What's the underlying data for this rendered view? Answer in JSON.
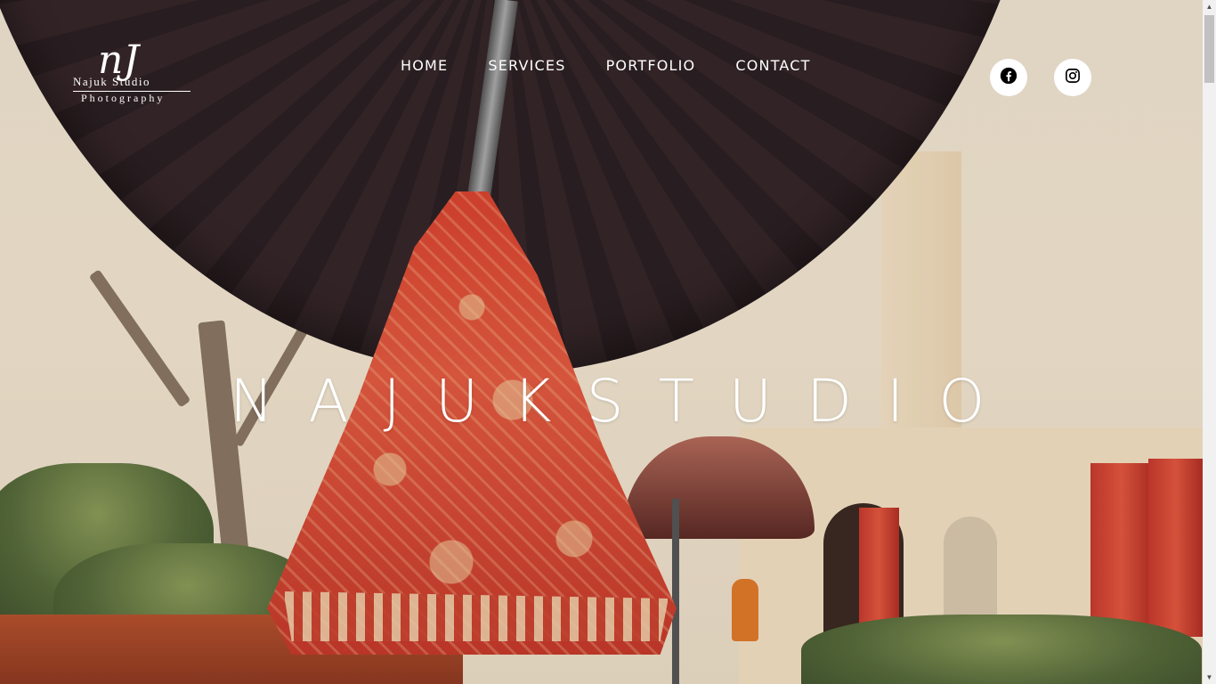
{
  "brand": {
    "mark": "nJ",
    "line1": "Najuk Studio",
    "line2": "Photography"
  },
  "nav": {
    "items": [
      {
        "label": "HOME"
      },
      {
        "label": "SERVICES"
      },
      {
        "label": "PORTFOLIO"
      },
      {
        "label": "CONTACT"
      }
    ]
  },
  "social": [
    {
      "icon": "facebook-icon"
    },
    {
      "icon": "instagram-icon"
    }
  ],
  "hero": {
    "title": "NAJUKSTUDIO"
  },
  "colors": {
    "nav_text": "#ffffff",
    "social_bg": "#ffffff",
    "icon": "#000000"
  }
}
